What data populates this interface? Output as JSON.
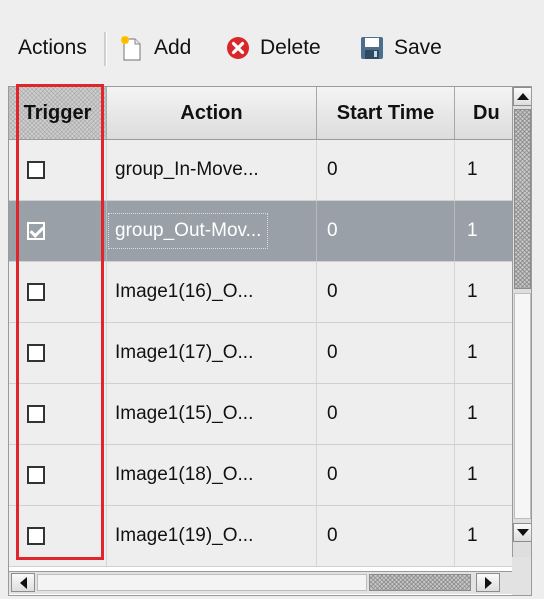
{
  "toolbar": {
    "actions_label": "Actions",
    "add_label": "Add",
    "delete_label": "Delete",
    "save_label": "Save"
  },
  "icons": {
    "add": "new-document-icon",
    "delete": "red-x-circle-icon",
    "save": "floppy-disk-icon"
  },
  "columns": [
    {
      "label": "Trigger"
    },
    {
      "label": "Action"
    },
    {
      "label": "Start Time"
    },
    {
      "label": "Du"
    }
  ],
  "rows": [
    {
      "trigger": false,
      "action": "group_In-Move...",
      "start_time": "0",
      "duration": "1"
    },
    {
      "trigger": true,
      "action": "group_Out-Mov...",
      "start_time": "0",
      "duration": "1",
      "selected": true
    },
    {
      "trigger": false,
      "action": "Image1(16)_O...",
      "start_time": "0",
      "duration": "1"
    },
    {
      "trigger": false,
      "action": "Image1(17)_O...",
      "start_time": "0",
      "duration": "1"
    },
    {
      "trigger": false,
      "action": "Image1(15)_O...",
      "start_time": "0",
      "duration": "1"
    },
    {
      "trigger": false,
      "action": "Image1(18)_O...",
      "start_time": "0",
      "duration": "1"
    },
    {
      "trigger": false,
      "action": "Image1(19)_O...",
      "start_time": "0",
      "duration": "1"
    }
  ],
  "colors": {
    "highlight": "#e0262b",
    "selected_row": "#9aa0a8"
  }
}
